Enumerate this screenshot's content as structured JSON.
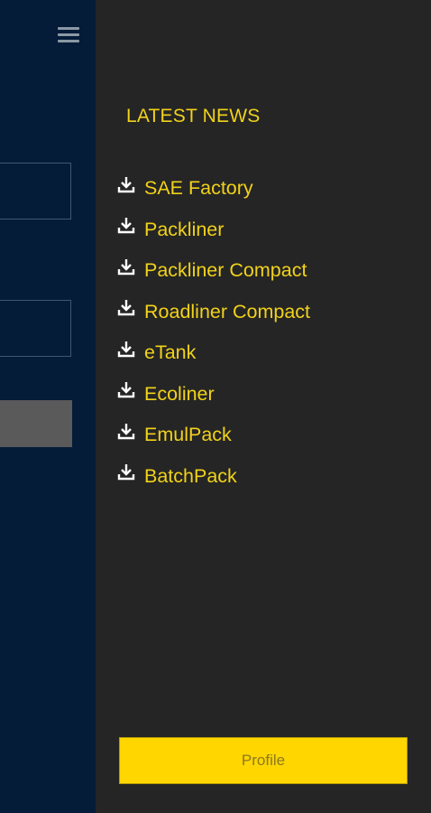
{
  "colors": {
    "left_panel_bg": "#041c38",
    "drawer_bg": "#252525",
    "accent": "#f1d21a",
    "button_bg": "#ffd600"
  },
  "header": {
    "menu_icon": "hamburger-menu-icon"
  },
  "news": {
    "title": "LATEST NEWS",
    "item_icon": "download-icon",
    "items": [
      "SAE Factory",
      "Packliner",
      "Packliner Compact",
      "Roadliner Compact",
      "eTank",
      "Ecoliner",
      "EmulPack",
      "BatchPack"
    ]
  },
  "footer": {
    "profile_label": "Profile"
  }
}
